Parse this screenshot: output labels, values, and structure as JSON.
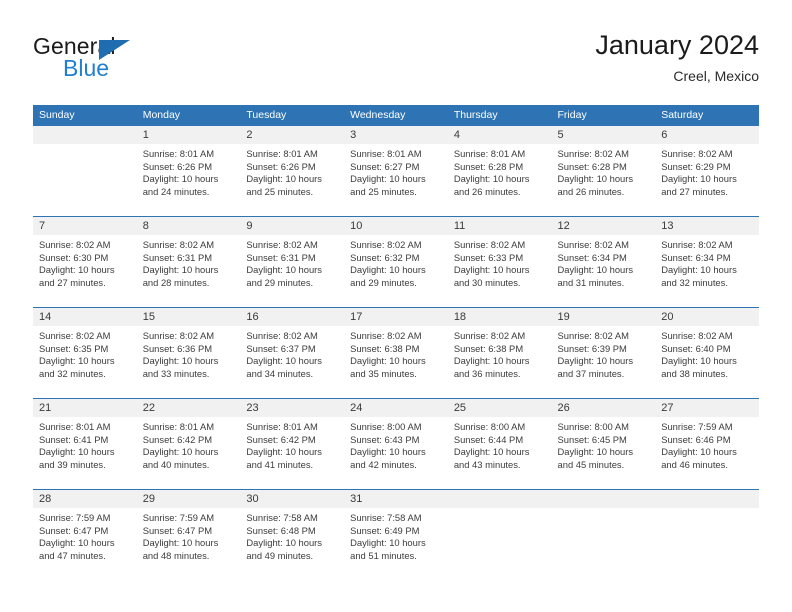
{
  "brand": {
    "name_top": "General",
    "name_bottom": "Blue",
    "accent_color": "#1f7fd0",
    "triangle_color": "#1f6cb0"
  },
  "header": {
    "title": "January 2024",
    "subtitle": "Creel, Mexico"
  },
  "theme": {
    "header_blue": "#2e74b5",
    "daynum_band": "#f1f1f1",
    "text": "#3c3c3c"
  },
  "weekday_headers": [
    "Sunday",
    "Monday",
    "Tuesday",
    "Wednesday",
    "Thursday",
    "Friday",
    "Saturday"
  ],
  "weeks": [
    [
      {
        "day": "",
        "sunrise": "",
        "sunset": "",
        "daylight_1": "",
        "daylight_2": "",
        "empty": true
      },
      {
        "day": "1",
        "sunrise": "Sunrise: 8:01 AM",
        "sunset": "Sunset: 6:26 PM",
        "daylight_1": "Daylight: 10 hours",
        "daylight_2": "and 24 minutes.",
        "empty": false
      },
      {
        "day": "2",
        "sunrise": "Sunrise: 8:01 AM",
        "sunset": "Sunset: 6:26 PM",
        "daylight_1": "Daylight: 10 hours",
        "daylight_2": "and 25 minutes.",
        "empty": false
      },
      {
        "day": "3",
        "sunrise": "Sunrise: 8:01 AM",
        "sunset": "Sunset: 6:27 PM",
        "daylight_1": "Daylight: 10 hours",
        "daylight_2": "and 25 minutes.",
        "empty": false
      },
      {
        "day": "4",
        "sunrise": "Sunrise: 8:01 AM",
        "sunset": "Sunset: 6:28 PM",
        "daylight_1": "Daylight: 10 hours",
        "daylight_2": "and 26 minutes.",
        "empty": false
      },
      {
        "day": "5",
        "sunrise": "Sunrise: 8:02 AM",
        "sunset": "Sunset: 6:28 PM",
        "daylight_1": "Daylight: 10 hours",
        "daylight_2": "and 26 minutes.",
        "empty": false
      },
      {
        "day": "6",
        "sunrise": "Sunrise: 8:02 AM",
        "sunset": "Sunset: 6:29 PM",
        "daylight_1": "Daylight: 10 hours",
        "daylight_2": "and 27 minutes.",
        "empty": false
      }
    ],
    [
      {
        "day": "7",
        "sunrise": "Sunrise: 8:02 AM",
        "sunset": "Sunset: 6:30 PM",
        "daylight_1": "Daylight: 10 hours",
        "daylight_2": "and 27 minutes.",
        "empty": false
      },
      {
        "day": "8",
        "sunrise": "Sunrise: 8:02 AM",
        "sunset": "Sunset: 6:31 PM",
        "daylight_1": "Daylight: 10 hours",
        "daylight_2": "and 28 minutes.",
        "empty": false
      },
      {
        "day": "9",
        "sunrise": "Sunrise: 8:02 AM",
        "sunset": "Sunset: 6:31 PM",
        "daylight_1": "Daylight: 10 hours",
        "daylight_2": "and 29 minutes.",
        "empty": false
      },
      {
        "day": "10",
        "sunrise": "Sunrise: 8:02 AM",
        "sunset": "Sunset: 6:32 PM",
        "daylight_1": "Daylight: 10 hours",
        "daylight_2": "and 29 minutes.",
        "empty": false
      },
      {
        "day": "11",
        "sunrise": "Sunrise: 8:02 AM",
        "sunset": "Sunset: 6:33 PM",
        "daylight_1": "Daylight: 10 hours",
        "daylight_2": "and 30 minutes.",
        "empty": false
      },
      {
        "day": "12",
        "sunrise": "Sunrise: 8:02 AM",
        "sunset": "Sunset: 6:34 PM",
        "daylight_1": "Daylight: 10 hours",
        "daylight_2": "and 31 minutes.",
        "empty": false
      },
      {
        "day": "13",
        "sunrise": "Sunrise: 8:02 AM",
        "sunset": "Sunset: 6:34 PM",
        "daylight_1": "Daylight: 10 hours",
        "daylight_2": "and 32 minutes.",
        "empty": false
      }
    ],
    [
      {
        "day": "14",
        "sunrise": "Sunrise: 8:02 AM",
        "sunset": "Sunset: 6:35 PM",
        "daylight_1": "Daylight: 10 hours",
        "daylight_2": "and 32 minutes.",
        "empty": false
      },
      {
        "day": "15",
        "sunrise": "Sunrise: 8:02 AM",
        "sunset": "Sunset: 6:36 PM",
        "daylight_1": "Daylight: 10 hours",
        "daylight_2": "and 33 minutes.",
        "empty": false
      },
      {
        "day": "16",
        "sunrise": "Sunrise: 8:02 AM",
        "sunset": "Sunset: 6:37 PM",
        "daylight_1": "Daylight: 10 hours",
        "daylight_2": "and 34 minutes.",
        "empty": false
      },
      {
        "day": "17",
        "sunrise": "Sunrise: 8:02 AM",
        "sunset": "Sunset: 6:38 PM",
        "daylight_1": "Daylight: 10 hours",
        "daylight_2": "and 35 minutes.",
        "empty": false
      },
      {
        "day": "18",
        "sunrise": "Sunrise: 8:02 AM",
        "sunset": "Sunset: 6:38 PM",
        "daylight_1": "Daylight: 10 hours",
        "daylight_2": "and 36 minutes.",
        "empty": false
      },
      {
        "day": "19",
        "sunrise": "Sunrise: 8:02 AM",
        "sunset": "Sunset: 6:39 PM",
        "daylight_1": "Daylight: 10 hours",
        "daylight_2": "and 37 minutes.",
        "empty": false
      },
      {
        "day": "20",
        "sunrise": "Sunrise: 8:02 AM",
        "sunset": "Sunset: 6:40 PM",
        "daylight_1": "Daylight: 10 hours",
        "daylight_2": "and 38 minutes.",
        "empty": false
      }
    ],
    [
      {
        "day": "21",
        "sunrise": "Sunrise: 8:01 AM",
        "sunset": "Sunset: 6:41 PM",
        "daylight_1": "Daylight: 10 hours",
        "daylight_2": "and 39 minutes.",
        "empty": false
      },
      {
        "day": "22",
        "sunrise": "Sunrise: 8:01 AM",
        "sunset": "Sunset: 6:42 PM",
        "daylight_1": "Daylight: 10 hours",
        "daylight_2": "and 40 minutes.",
        "empty": false
      },
      {
        "day": "23",
        "sunrise": "Sunrise: 8:01 AM",
        "sunset": "Sunset: 6:42 PM",
        "daylight_1": "Daylight: 10 hours",
        "daylight_2": "and 41 minutes.",
        "empty": false
      },
      {
        "day": "24",
        "sunrise": "Sunrise: 8:00 AM",
        "sunset": "Sunset: 6:43 PM",
        "daylight_1": "Daylight: 10 hours",
        "daylight_2": "and 42 minutes.",
        "empty": false
      },
      {
        "day": "25",
        "sunrise": "Sunrise: 8:00 AM",
        "sunset": "Sunset: 6:44 PM",
        "daylight_1": "Daylight: 10 hours",
        "daylight_2": "and 43 minutes.",
        "empty": false
      },
      {
        "day": "26",
        "sunrise": "Sunrise: 8:00 AM",
        "sunset": "Sunset: 6:45 PM",
        "daylight_1": "Daylight: 10 hours",
        "daylight_2": "and 45 minutes.",
        "empty": false
      },
      {
        "day": "27",
        "sunrise": "Sunrise: 7:59 AM",
        "sunset": "Sunset: 6:46 PM",
        "daylight_1": "Daylight: 10 hours",
        "daylight_2": "and 46 minutes.",
        "empty": false
      }
    ],
    [
      {
        "day": "28",
        "sunrise": "Sunrise: 7:59 AM",
        "sunset": "Sunset: 6:47 PM",
        "daylight_1": "Daylight: 10 hours",
        "daylight_2": "and 47 minutes.",
        "empty": false
      },
      {
        "day": "29",
        "sunrise": "Sunrise: 7:59 AM",
        "sunset": "Sunset: 6:47 PM",
        "daylight_1": "Daylight: 10 hours",
        "daylight_2": "and 48 minutes.",
        "empty": false
      },
      {
        "day": "30",
        "sunrise": "Sunrise: 7:58 AM",
        "sunset": "Sunset: 6:48 PM",
        "daylight_1": "Daylight: 10 hours",
        "daylight_2": "and 49 minutes.",
        "empty": false
      },
      {
        "day": "31",
        "sunrise": "Sunrise: 7:58 AM",
        "sunset": "Sunset: 6:49 PM",
        "daylight_1": "Daylight: 10 hours",
        "daylight_2": "and 51 minutes.",
        "empty": false
      },
      {
        "day": "",
        "sunrise": "",
        "sunset": "",
        "daylight_1": "",
        "daylight_2": "",
        "empty": true
      },
      {
        "day": "",
        "sunrise": "",
        "sunset": "",
        "daylight_1": "",
        "daylight_2": "",
        "empty": true
      },
      {
        "day": "",
        "sunrise": "",
        "sunset": "",
        "daylight_1": "",
        "daylight_2": "",
        "empty": true
      }
    ]
  ]
}
